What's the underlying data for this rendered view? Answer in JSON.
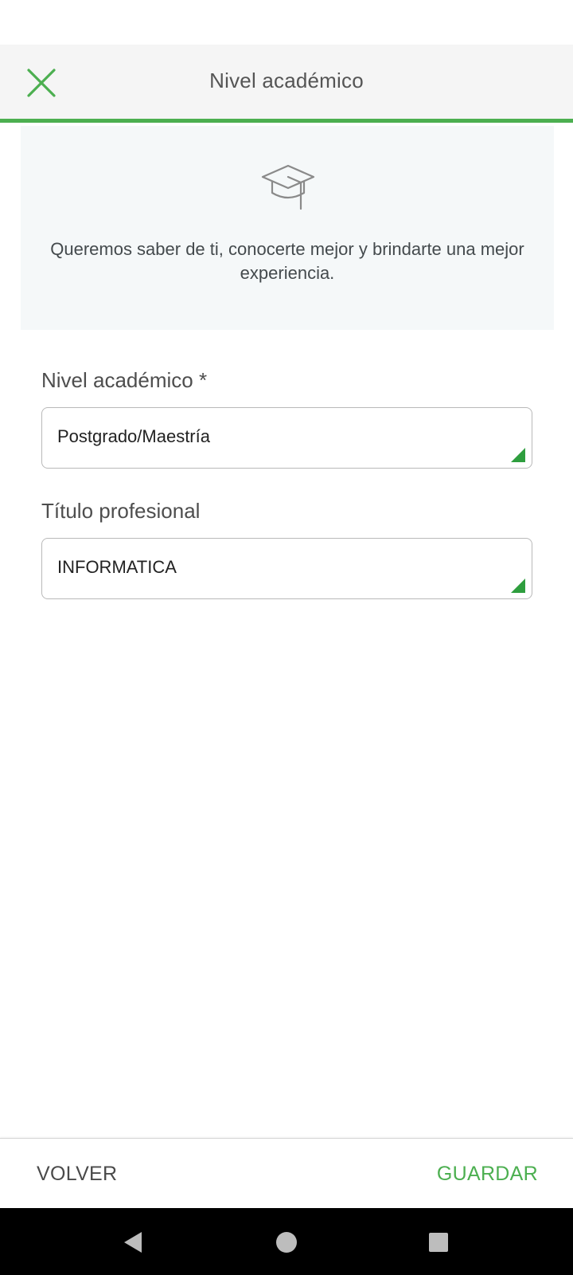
{
  "header": {
    "title": "Nivel académico",
    "close_icon": "close-icon",
    "accent_color": "#4caf50"
  },
  "info": {
    "icon": "graduation-cap-icon",
    "text": "Queremos saber de ti, conocerte mejor y brindarte una mejor experiencia."
  },
  "form": {
    "academic_level": {
      "label": "Nivel académico *",
      "value": "Postgrado/Maestría"
    },
    "professional_title": {
      "label": "Título profesional",
      "value": "INFORMATICA"
    }
  },
  "footer": {
    "back_label": "VOLVER",
    "save_label": "GUARDAR"
  },
  "system_nav": {
    "back_icon": "nav-back-icon",
    "home_icon": "nav-home-icon",
    "recents_icon": "nav-recents-icon"
  }
}
